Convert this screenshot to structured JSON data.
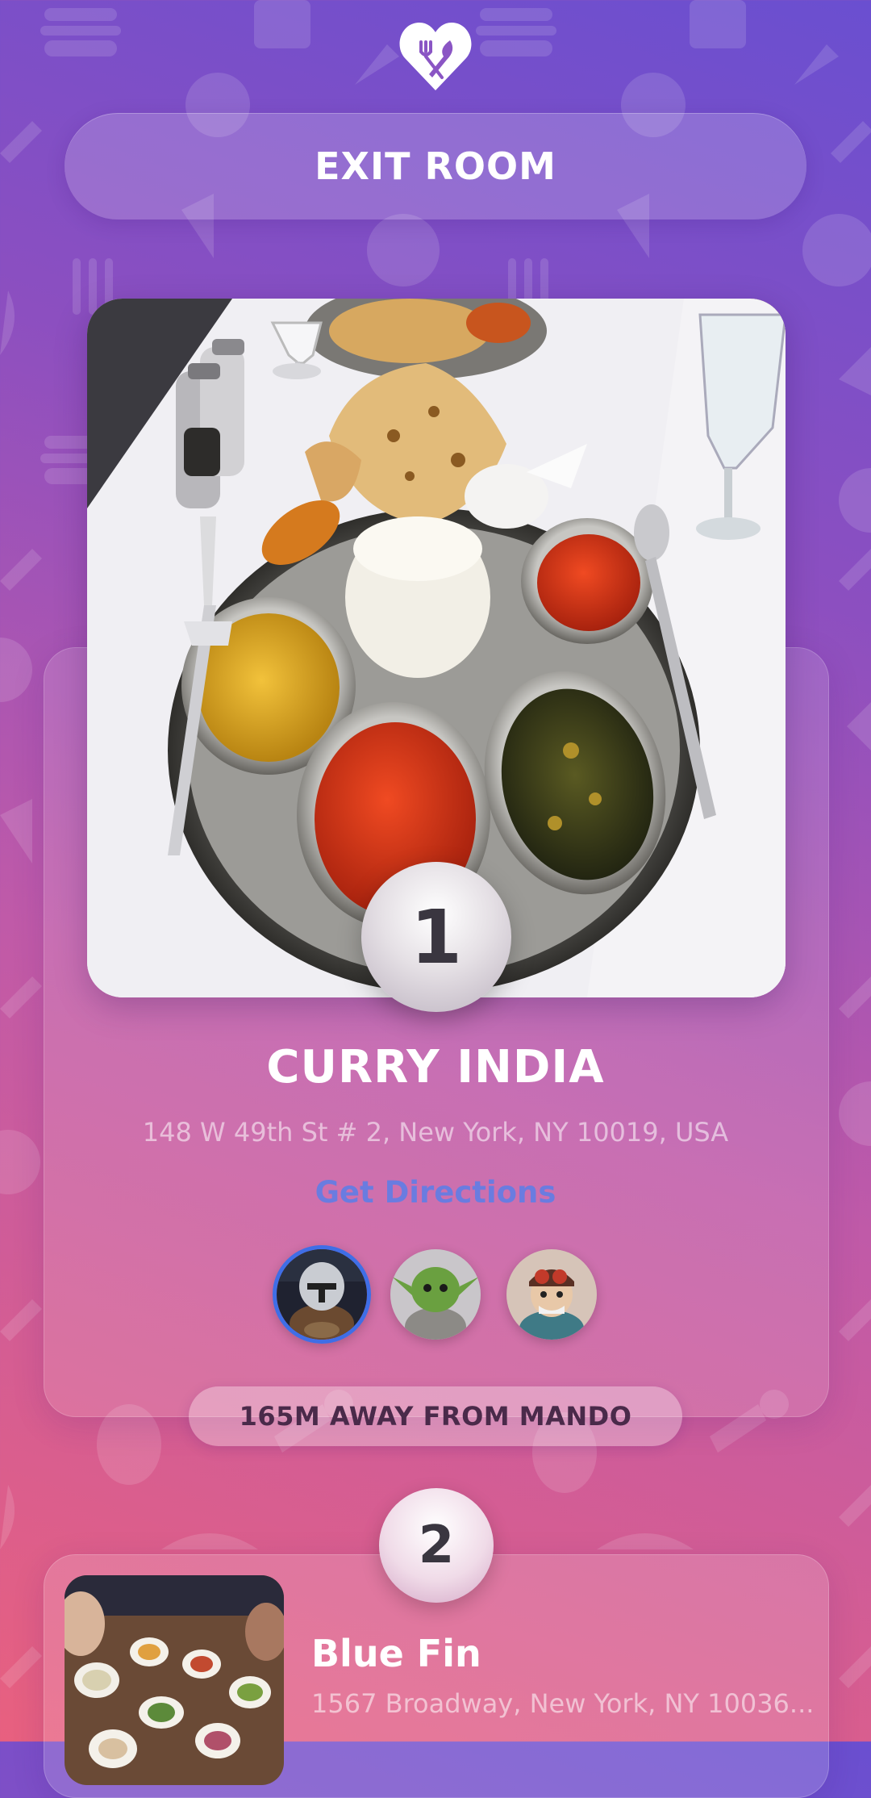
{
  "header": {
    "logo_icon": "heart-fork-knife-icon",
    "exit_label": "EXIT ROOM"
  },
  "results": [
    {
      "rank": "1",
      "name": "CURRY INDIA",
      "address": "148 W 49th St # 2, New York, NY 10019, USA",
      "directions_label": "Get Directions",
      "voters": [
        "mando-avatar",
        "yoda-avatar",
        "aviator-avatar"
      ],
      "distance": "165M AWAY FROM MANDO"
    },
    {
      "rank": "2",
      "name": "Blue Fin",
      "address": "1567 Broadway, New York, NY 10036..."
    }
  ],
  "colors": {
    "background_top": "#6a4fd0",
    "background_bottom": "#e8607f",
    "directions_link": "#6a7ce0",
    "selected_avatar_ring": "#3f6ee6"
  }
}
